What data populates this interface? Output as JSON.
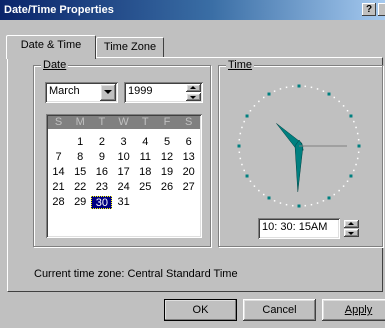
{
  "window": {
    "title": "Date/Time Properties",
    "help_glyph": "?"
  },
  "tabs": [
    {
      "label": "Date & Time",
      "active": true
    },
    {
      "label": "Time Zone",
      "active": false
    }
  ],
  "date_group": {
    "label": "Date",
    "month": "March",
    "year": "1999",
    "weekday_headers": [
      "S",
      "M",
      "T",
      "W",
      "T",
      "F",
      "S"
    ],
    "weeks": [
      [
        "",
        "1",
        "2",
        "3",
        "4",
        "5",
        "6"
      ],
      [
        "7",
        "8",
        "9",
        "10",
        "11",
        "12",
        "13"
      ],
      [
        "14",
        "15",
        "16",
        "17",
        "18",
        "19",
        "20"
      ],
      [
        "21",
        "22",
        "23",
        "24",
        "25",
        "26",
        "27"
      ],
      [
        "28",
        "29",
        "30",
        "31",
        "",
        "",
        ""
      ]
    ],
    "selected_day": "30"
  },
  "time_group": {
    "label": "Time",
    "value": "10: 30: 15AM"
  },
  "current_time_zone": "Current time zone:  Central Standard Time",
  "buttons": {
    "ok": "OK",
    "cancel": "Cancel",
    "apply": "Apply"
  },
  "colors": {
    "titlebar": "#0a246a",
    "face": "#c0c0c0",
    "hand": "#008080",
    "selection": "#000080"
  }
}
